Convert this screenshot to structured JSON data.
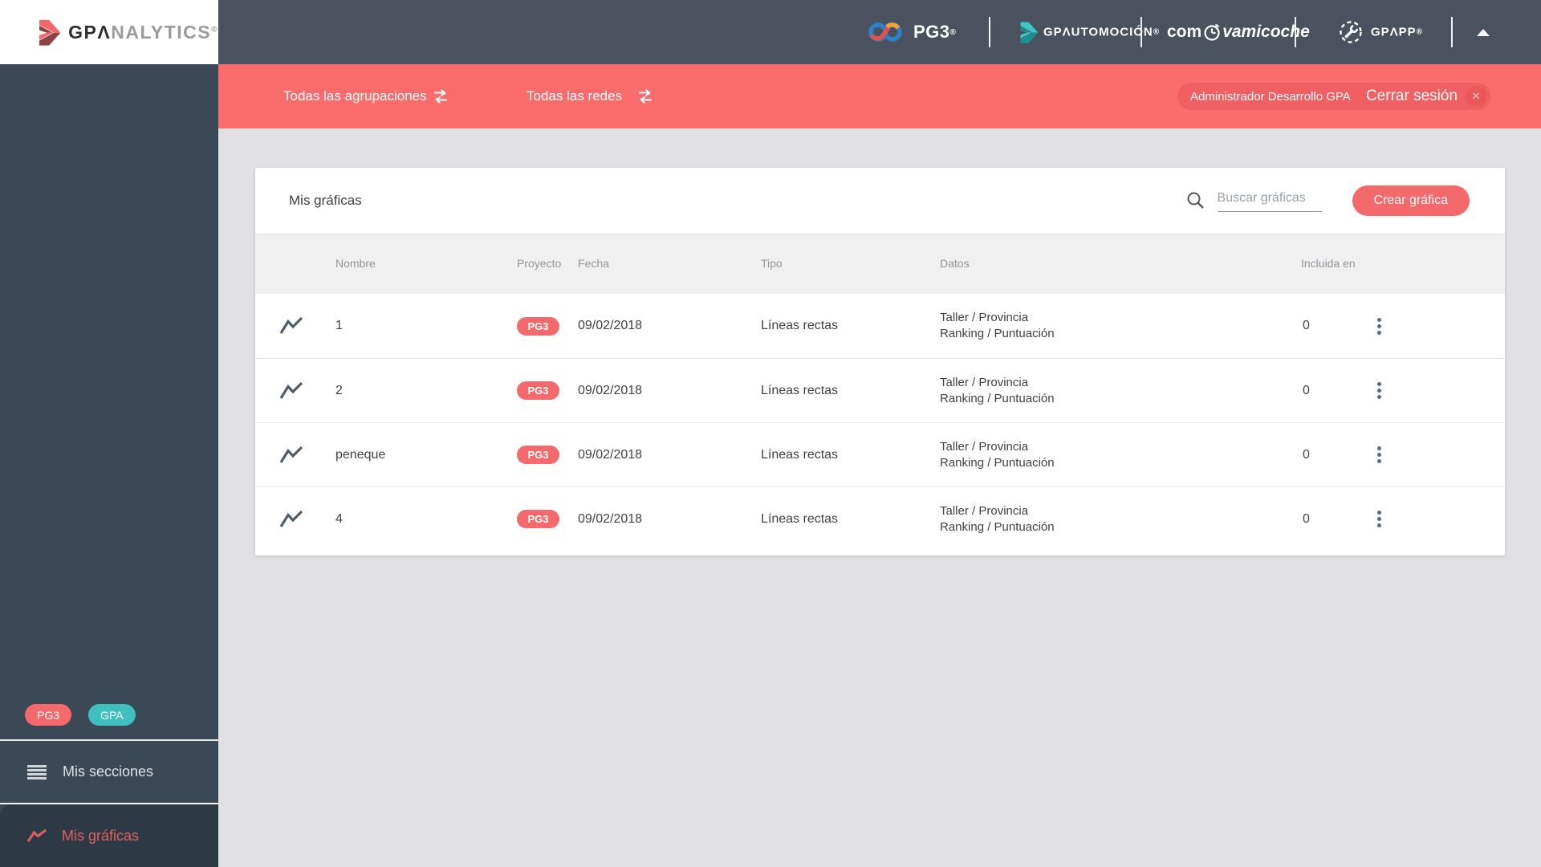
{
  "brand": {
    "gpa": "GPΛ",
    "nalytics": "NALYTICS",
    "reg": "®"
  },
  "header": {
    "pg3_label": "PG3",
    "gpautomocion_label": "GPΛUTOMOCIÓN",
    "comprovamicoche_pre": "com",
    "comprovamicoche_post": "vamicoche",
    "gpapp_label": "GPΛPP"
  },
  "filterbar": {
    "groups": "Todas las agrupaciones",
    "networks": "Todas las redes",
    "user": "Administrador Desarrollo GPA",
    "logout": "Cerrar sesión",
    "logout_icon": "✕"
  },
  "sidebar": {
    "badge_pg3": "PG3",
    "badge_gpa": "GPA",
    "sections_label": "Mis secciones",
    "charts_label": "Mis gráficas"
  },
  "main": {
    "title": "Mis gráficas",
    "search_placeholder": "Buscar gráficas",
    "create_button": "Crear gráfica",
    "table": {
      "headers": [
        "Nombre",
        "Proyecto",
        "Fecha",
        "Tipo",
        "Datos",
        "Incluida en"
      ],
      "rows": [
        {
          "name": "1",
          "project": "PG3",
          "date": "09/02/2018",
          "type": "Líneas rectas",
          "data_line1": "Taller / Provincia",
          "data_line2": "Ranking / Puntuación",
          "included": "0"
        },
        {
          "name": "2",
          "project": "PG3",
          "date": "09/02/2018",
          "type": "Líneas rectas",
          "data_line1": "Taller / Provincia",
          "data_line2": "Ranking / Puntuación",
          "included": "0"
        },
        {
          "name": "peneque",
          "project": "PG3",
          "date": "09/02/2018",
          "type": "Líneas rectas",
          "data_line1": "Taller / Provincia",
          "data_line2": "Ranking / Puntuación",
          "included": "0"
        },
        {
          "name": "4",
          "project": "PG3",
          "date": "09/02/2018",
          "type": "Líneas rectas",
          "data_line1": "Taller / Provincia",
          "data_line2": "Ranking / Puntuación",
          "included": "0"
        }
      ]
    }
  },
  "colors": {
    "accent_coral": "#f4696b",
    "brand_teal": "#3fc0bf",
    "header_dark": "#4a5260",
    "sidebar_dark": "#3b4855",
    "red_bar": "#fa6b6b"
  }
}
